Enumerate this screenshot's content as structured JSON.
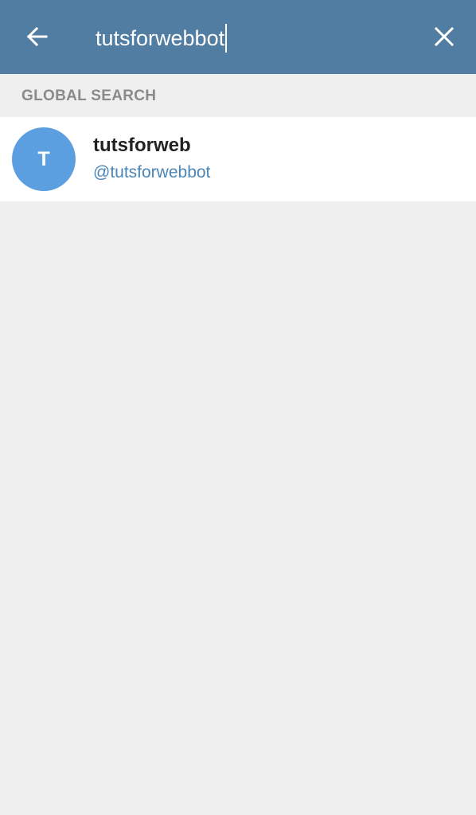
{
  "search": {
    "query": "tutsforwebbot"
  },
  "icons": {
    "back": "arrow-left-icon",
    "clear": "close-icon"
  },
  "section": {
    "title": "GLOBAL SEARCH"
  },
  "results": [
    {
      "avatar_letter": "T",
      "name": "tutsforweb",
      "username": "@tutsforwebbot"
    }
  ],
  "colors": {
    "header": "#527da3",
    "avatar": "#5b9fe0",
    "username": "#4a86b8",
    "background": "#efefef"
  }
}
